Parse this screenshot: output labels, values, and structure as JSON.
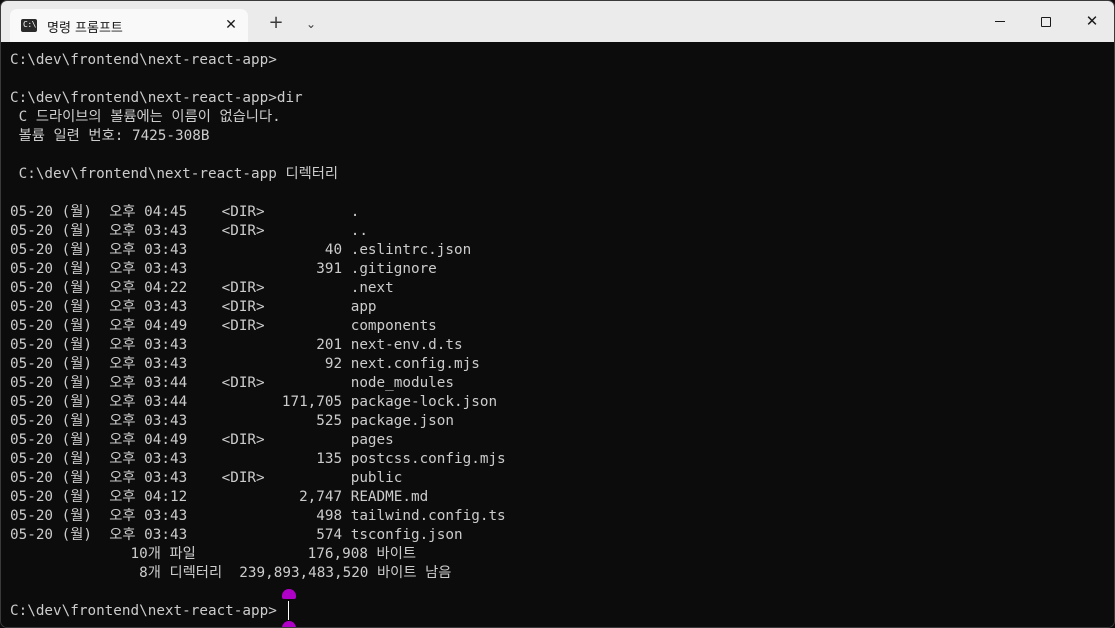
{
  "window": {
    "tab_title": "명령 프롬프트",
    "tab_icon": "cmd-icon",
    "tab_close": "✕",
    "new_tab": "+",
    "dropdown": "⌄",
    "close": "✕"
  },
  "terminal": {
    "lines": [
      "C:\\dev\\frontend\\next-react-app>",
      "",
      "C:\\dev\\frontend\\next-react-app>dir",
      " C 드라이브의 볼륨에는 이름이 없습니다.",
      " 볼륨 일련 번호: 7425-308B",
      "",
      " C:\\dev\\frontend\\next-react-app 디렉터리",
      "",
      "05-20 (월)  오후 04:45    <DIR>          .",
      "05-20 (월)  오후 03:43    <DIR>          ..",
      "05-20 (월)  오후 03:43                40 .eslintrc.json",
      "05-20 (월)  오후 03:43               391 .gitignore",
      "05-20 (월)  오후 04:22    <DIR>          .next",
      "05-20 (월)  오후 03:43    <DIR>          app",
      "05-20 (월)  오후 04:49    <DIR>          components",
      "05-20 (월)  오후 03:43               201 next-env.d.ts",
      "05-20 (월)  오후 03:43                92 next.config.mjs",
      "05-20 (월)  오후 03:44    <DIR>          node_modules",
      "05-20 (월)  오후 03:44           171,705 package-lock.json",
      "05-20 (월)  오후 03:43               525 package.json",
      "05-20 (월)  오후 04:49    <DIR>          pages",
      "05-20 (월)  오후 03:43               135 postcss.config.mjs",
      "05-20 (월)  오후 03:43    <DIR>          public",
      "05-20 (월)  오후 04:12             2,747 README.md",
      "05-20 (월)  오후 03:43               498 tailwind.config.ts",
      "05-20 (월)  오후 03:43               574 tsconfig.json",
      "              10개 파일             176,908 바이트",
      "               8개 디렉터리  239,893,483,520 바이트 남음",
      "",
      "C:\\dev\\frontend\\next-react-app>"
    ]
  }
}
